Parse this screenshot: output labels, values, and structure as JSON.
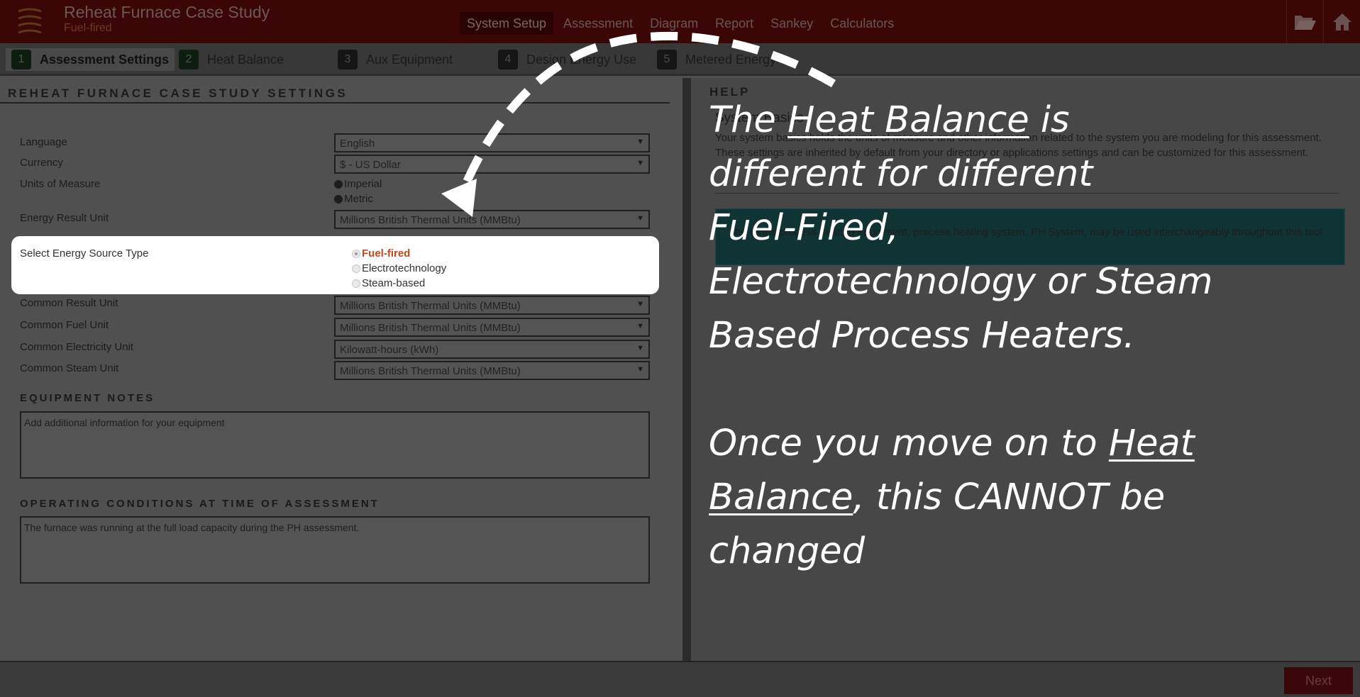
{
  "header": {
    "title": "Reheat Furnace Case Study",
    "subtitle": "Fuel-fired",
    "nav": [
      "System Setup",
      "Assessment",
      "Diagram",
      "Report",
      "Sankey",
      "Calculators"
    ]
  },
  "steps": [
    {
      "num": "1",
      "label": "Assessment Settings"
    },
    {
      "num": "2",
      "label": "Heat Balance"
    },
    {
      "num": "3",
      "label": "Aux Equipment"
    },
    {
      "num": "4",
      "label": "Design Energy Use"
    },
    {
      "num": "5",
      "label": "Metered Energy"
    }
  ],
  "settings": {
    "section_title": "REHEAT FURNACE CASE STUDY SETTINGS",
    "language_label": "Language",
    "language_value": "English",
    "currency_label": "Currency",
    "currency_value": "$ - US Dollar",
    "units_label": "Units of Measure",
    "units_imperial": "Imperial",
    "units_metric": "Metric",
    "energy_result_label": "Energy Result Unit",
    "energy_result_value": "Millions British Thermal Units (MMBtu)",
    "source_label": "Select Energy Source Type",
    "source_options": [
      "Fuel-fired",
      "Electrotechnology",
      "Steam-based"
    ],
    "common_result_label": "Common Result Unit",
    "common_result_value": "Millions British Thermal Units (MMBtu)",
    "common_fuel_label": "Common Fuel Unit",
    "common_fuel_value": "Millions British Thermal Units (MMBtu)",
    "common_electricity_label": "Common Electricity Unit",
    "common_electricity_value": "Kilowatt-hours (kWh)",
    "common_steam_label": "Common Steam Unit",
    "common_steam_value": "Millions British Thermal Units (MMBtu)",
    "equipment_notes_title": "EQUIPMENT NOTES",
    "equipment_notes_placeholder": "Add additional information for your equipment",
    "operating_title": "OPERATING CONDITIONS AT TIME OF ASSESSMENT",
    "operating_value": "The furnace was running at the full load capacity during the PH assessment."
  },
  "help": {
    "title": "HELP",
    "heading": "System Basics",
    "paragraph": "Your system basics holds the units of measure and other information related to the system you are modeling for this assessment. These settings are inherited by default from your directory or applications settings and can be customized for this assessment.",
    "box_text": "The terms process heating equipment, process heating system, PH System, may be used interchangeably throughout this tool."
  },
  "annotation": {
    "line1_pre": "The ",
    "line1_u": "Heat Balance",
    "line1_post": " is",
    "line2": "different for different",
    "line3": "Fuel-Fired,",
    "line4": "Electrotechnology or Steam",
    "line5": "Based Process Heaters.",
    "line6_pre": "Once you move on to ",
    "line6_u": "Heat",
    "line7_u": "Balance",
    "line7_post": ", this CANNOT be",
    "line8": "changed"
  },
  "footer": {
    "next_label": "Next"
  }
}
